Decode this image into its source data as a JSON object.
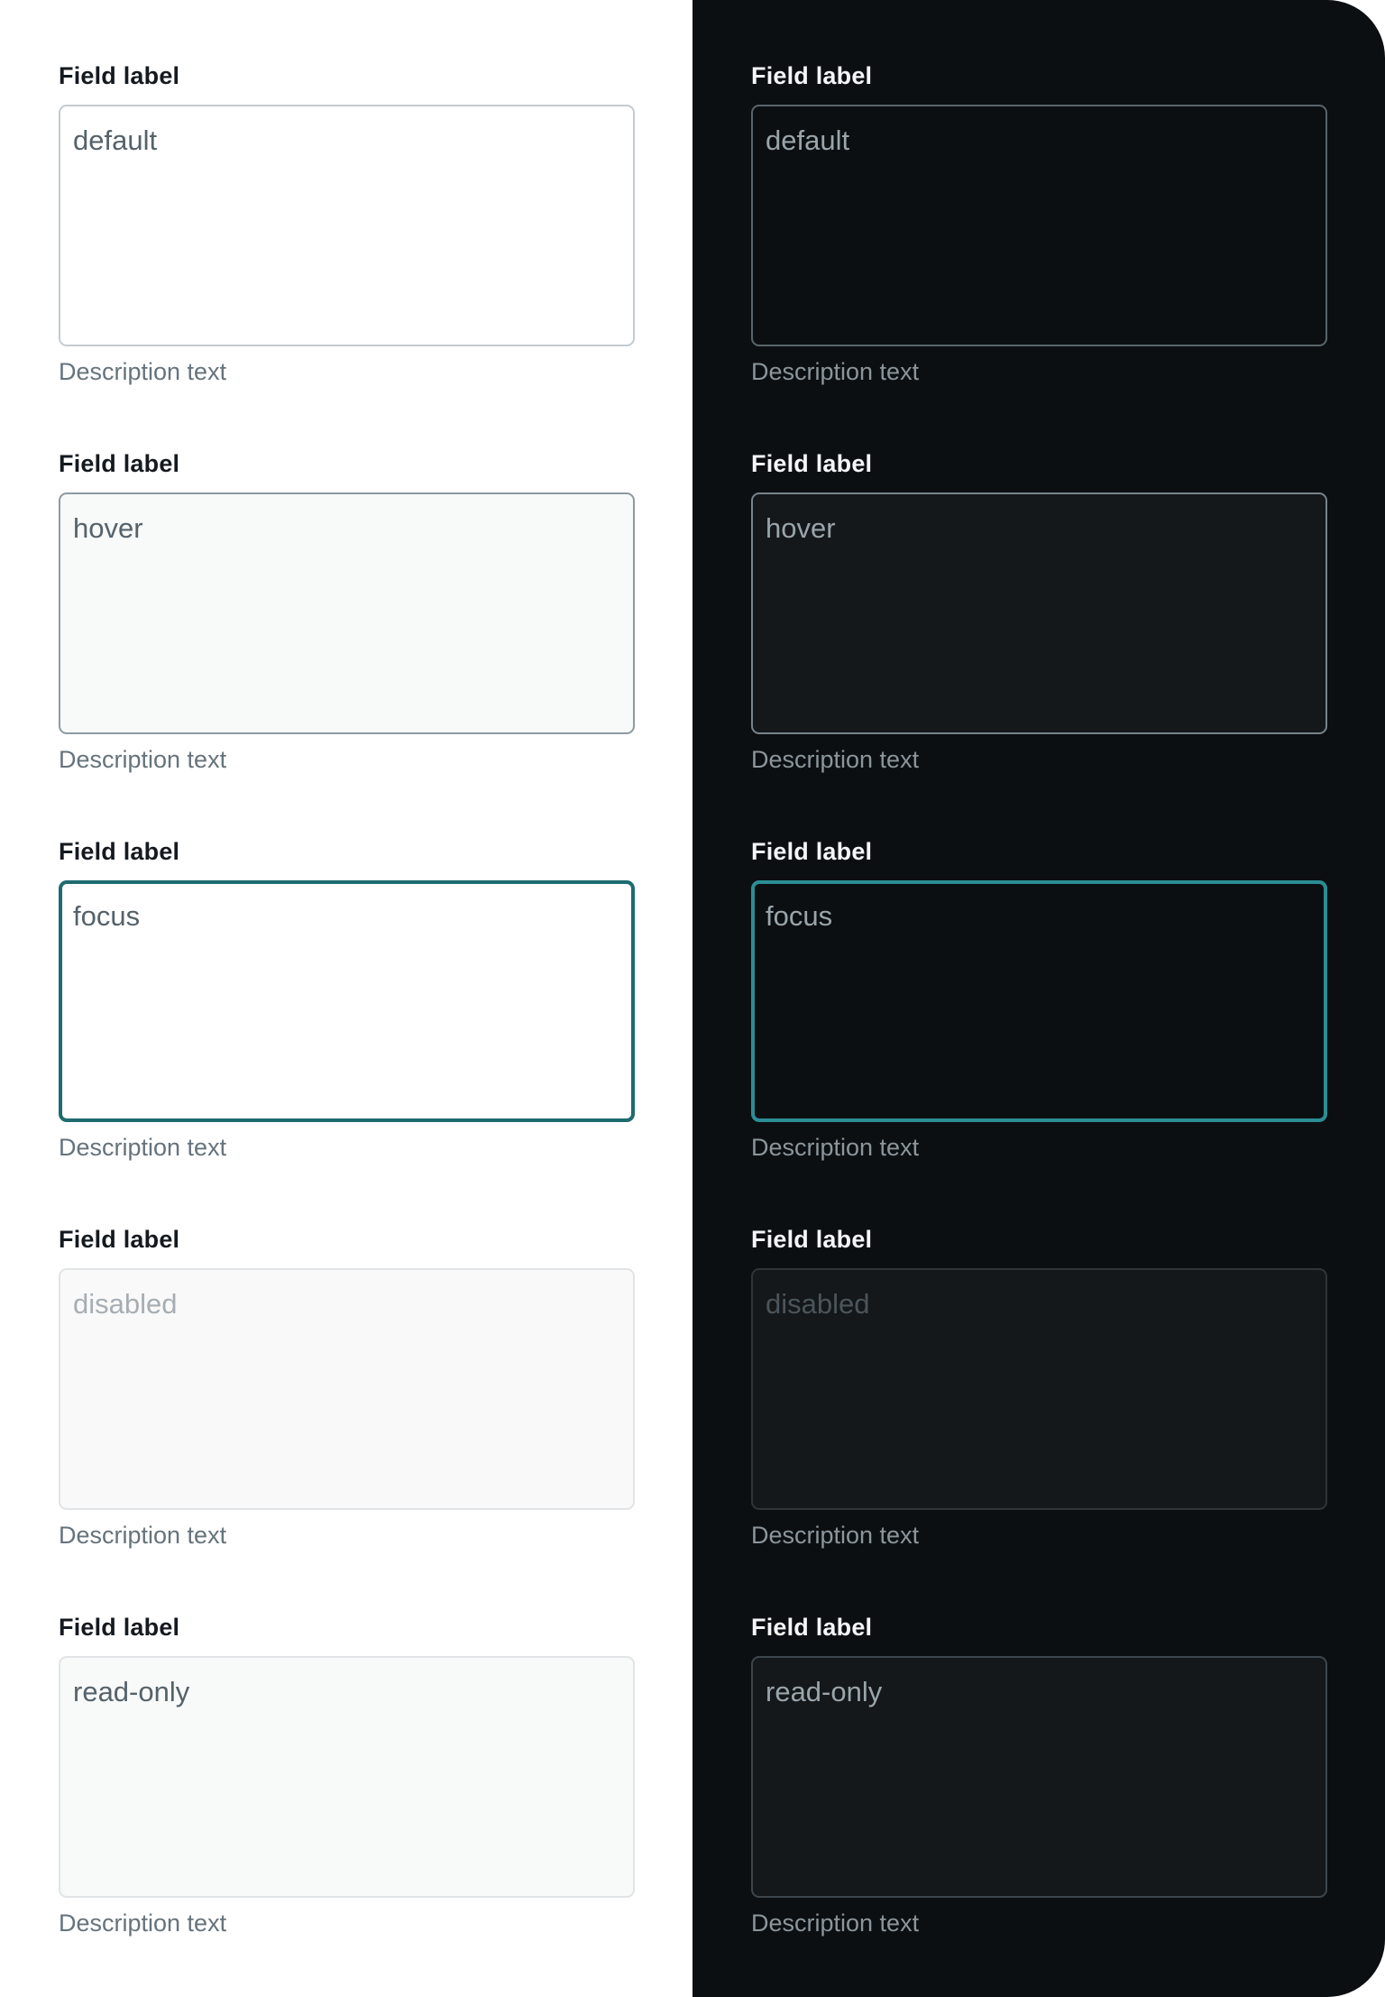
{
  "fields": [
    {
      "label": "Field label",
      "value": "default",
      "description": "Description text"
    },
    {
      "label": "Field label",
      "value": "hover",
      "description": "Description text"
    },
    {
      "label": "Field label",
      "value": "focus",
      "description": "Description text"
    },
    {
      "label": "Field label",
      "value": "disabled",
      "description": "Description text"
    },
    {
      "label": "Field label",
      "value": "read-only",
      "description": "Description text"
    }
  ],
  "colors": {
    "light_background": "#ffffff",
    "dark_background": "#0c0f12",
    "focus_light": "#1e6b70",
    "focus_dark": "#2b8d94"
  }
}
